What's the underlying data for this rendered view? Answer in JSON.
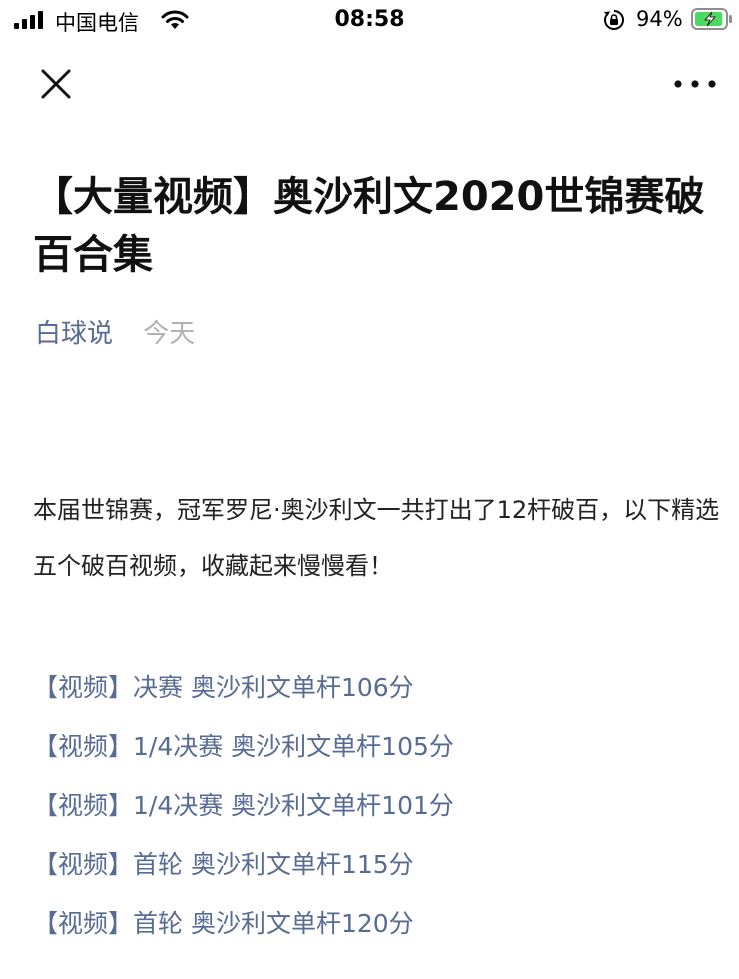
{
  "status_bar": {
    "carrier": "中国电信",
    "time": "08:58",
    "battery_percent": "94%",
    "battery_level": 0.94
  },
  "nav": {
    "close_icon": "close-icon",
    "more_icon": "more-icon"
  },
  "article": {
    "title": "【大量视频】奥沙利文2020世锦赛破百合集",
    "author": "白球说",
    "date": "今天",
    "intro": "本届世锦赛，冠军罗尼·奥沙利文一共打出了12杆破百，以下精选五个破百视频，收藏起来慢慢看！",
    "video_links": [
      "【视频】决赛 奥沙利文单杆106分",
      "【视频】1/4决赛 奥沙利文单杆105分",
      "【视频】1/4决赛 奥沙利文单杆101分",
      "【视频】首轮 奥沙利文单杆115分",
      "【视频】首轮 奥沙利文单杆120分"
    ]
  },
  "colors": {
    "link": "#576b95",
    "muted": "#b2b2b2",
    "battery_fill": "#4cd964"
  }
}
